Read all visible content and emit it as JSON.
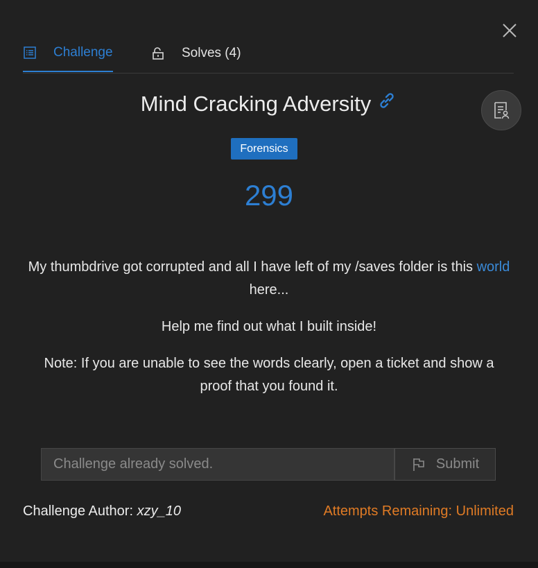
{
  "tabs": [
    {
      "label": "Challenge",
      "icon": "list-icon",
      "active": true
    },
    {
      "label": "Solves (4)",
      "icon": "unlock-icon",
      "active": false
    }
  ],
  "challenge": {
    "title": "Mind Cracking Adversity",
    "category": "Forensics",
    "points": "299",
    "description": {
      "para1_before": "My thumbdrive got corrupted and all I have left of my /saves folder is this",
      "para1_link": "world",
      "para1_after": "here...",
      "para2": "Help me find out what I built inside!",
      "para3": "Note: If you are unable to see the words clearly, open a ticket and show a proof that you found it."
    }
  },
  "form": {
    "placeholder": "Challenge already solved.",
    "submit_label": "Submit"
  },
  "footer": {
    "author_label": "Challenge Author:",
    "author_name": "xzy_10",
    "attempts": "Attempts Remaining: Unlimited"
  },
  "colors": {
    "accent": "#2d7fd3",
    "badge": "#1f6fbf",
    "warning": "#e07b25",
    "modal_bg": "#212121"
  }
}
